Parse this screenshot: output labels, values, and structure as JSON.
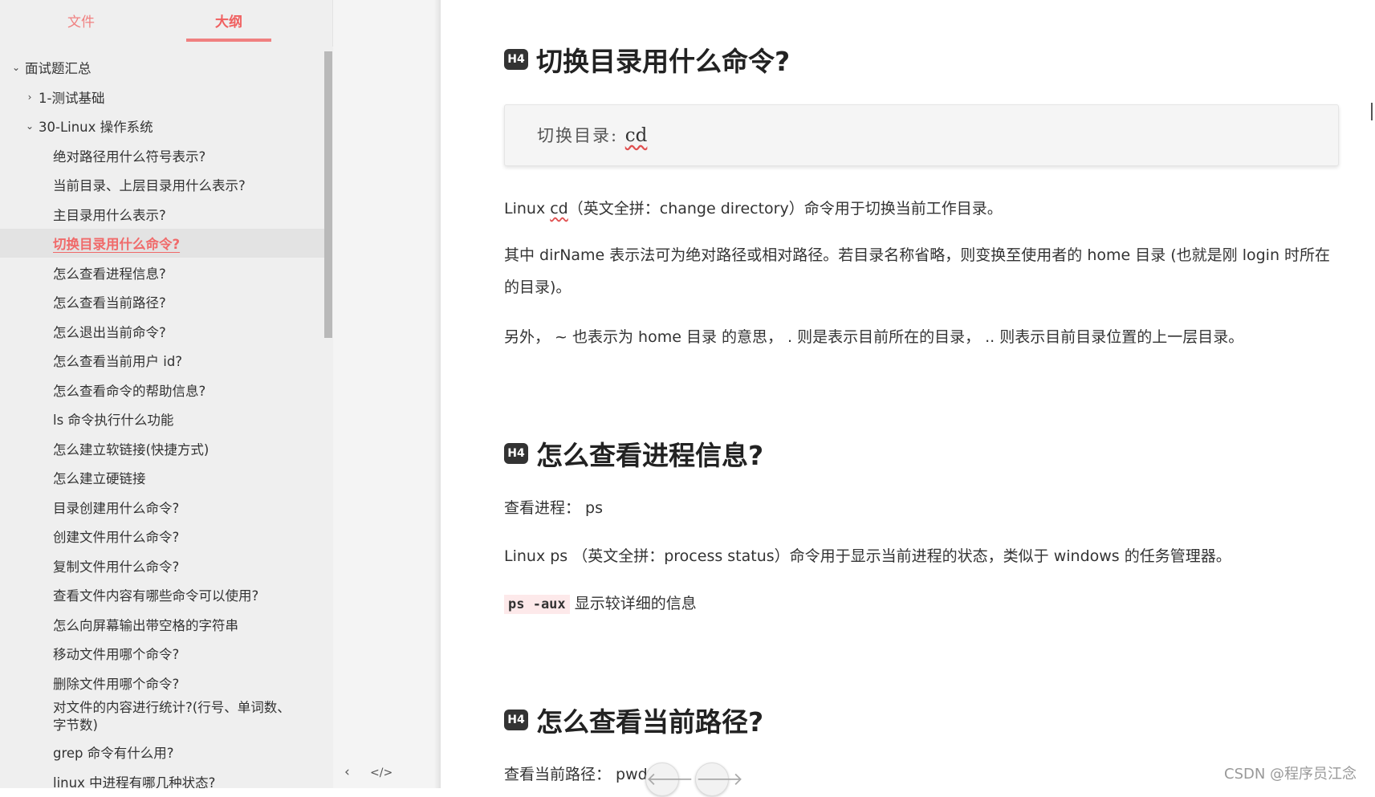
{
  "tabs": {
    "files": "文件",
    "outline": "大纲"
  },
  "outline": [
    {
      "text": "面试题汇总",
      "level": 1,
      "chevron": "⌄"
    },
    {
      "text": "1-测试基础",
      "level": 2,
      "chevron": "›"
    },
    {
      "text": "30-Linux 操作系统",
      "level": 2,
      "chevron": "⌄"
    },
    {
      "text": "绝对路径用什么符号表示?",
      "level": 3
    },
    {
      "text": "当前目录、上层目录用什么表示?",
      "level": 3
    },
    {
      "text": "主目录用什么表示?",
      "level": 3
    },
    {
      "text": "切换目录用什么命令?",
      "level": 3,
      "active": true
    },
    {
      "text": "怎么查看进程信息?",
      "level": 3
    },
    {
      "text": "怎么查看当前路径?",
      "level": 3
    },
    {
      "text": "怎么退出当前命令?",
      "level": 3
    },
    {
      "text": "怎么查看当前用户 id?",
      "level": 3
    },
    {
      "text": "怎么查看命令的帮助信息?",
      "level": 3
    },
    {
      "text": "ls 命令执行什么功能",
      "level": 3
    },
    {
      "text": "怎么建立软链接(快捷方式)",
      "level": 3
    },
    {
      "text": "怎么建立硬链接",
      "level": 3
    },
    {
      "text": "目录创建用什么命令?",
      "level": 3
    },
    {
      "text": "创建文件用什么命令?",
      "level": 3
    },
    {
      "text": "复制文件用什么命令?",
      "level": 3
    },
    {
      "text": "查看文件内容有哪些命令可以使用?",
      "level": 3
    },
    {
      "text": "怎么向屏幕输出带空格的字符串",
      "level": 3
    },
    {
      "text": "移动文件用哪个命令?",
      "level": 3
    },
    {
      "text": "删除文件用哪个命令?",
      "level": 3
    },
    {
      "text": "对文件的内容进行统计?(行号、单词数、字节数)",
      "level": 3,
      "wrap": true
    },
    {
      "text": "grep 命令有什么用?",
      "level": 3
    },
    {
      "text": "linux 中进程有哪几种状态?",
      "level": 3
    }
  ],
  "gutter": {
    "collapse_icon": "‹",
    "source_icon": "</>"
  },
  "content": {
    "badge": "H4",
    "section1": {
      "heading": "切换目录用什么命令?",
      "code_label": "切换目录:",
      "code_cmd": "cd",
      "p1_a": "Linux ",
      "p1_cd": "cd",
      "p1_b": "（英文全拼：change directory）命令用于切换当前工作目录。",
      "p2": "其中 dirName 表示法可为绝对路径或相对路径。若目录名称省略，则变换至使用者的 home 目录 (也就是刚 login 时所在的目录)。",
      "p3": "另外， ~ 也表示为 home 目录 的意思， . 则是表示目前所在的目录， .. 则表示目前目录位置的上一层目录。"
    },
    "section2": {
      "heading": "怎么查看进程信息?",
      "p1": "查看进程： ps",
      "p2": "Linux ps （英文全拼：process status）命令用于显示当前进程的状态，类似于 windows 的任务管理器。",
      "code": "ps -aux",
      "code_desc": " 显示较详细的信息"
    },
    "section3": {
      "heading": "怎么查看当前路径?",
      "p1": "查看当前路径： pwd"
    },
    "nav": {
      "prev_icon": "🡐",
      "next_icon": "🡒"
    }
  },
  "watermark": "CSDN @程序员江念",
  "colors": {
    "accent": "#f08080",
    "sidebar_bg": "#efefef",
    "active_bg": "#e3e3e3"
  }
}
